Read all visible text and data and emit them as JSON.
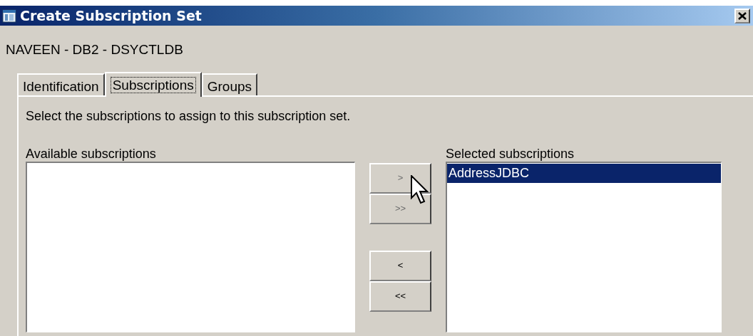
{
  "window": {
    "title": "Create Subscription Set"
  },
  "subtitle": "NAVEEN - DB2 - DSYCTLDB",
  "tabs": [
    {
      "label": "Identification",
      "selected": false
    },
    {
      "label": "Subscriptions",
      "selected": true
    },
    {
      "label": "Groups",
      "selected": false
    }
  ],
  "instruction": "Select the subscriptions to assign to this subscription set.",
  "available": {
    "label": "Available subscriptions"
  },
  "move_buttons": [
    {
      "label": ">",
      "disabled": true
    },
    {
      "label": ">>",
      "disabled": true
    },
    {
      "label": "<",
      "disabled": false
    },
    {
      "label": "<<",
      "disabled": false
    }
  ],
  "selected": {
    "label": "Selected subscriptions",
    "items": [
      {
        "label": "AddressJDBC",
        "selected": true
      }
    ]
  }
}
